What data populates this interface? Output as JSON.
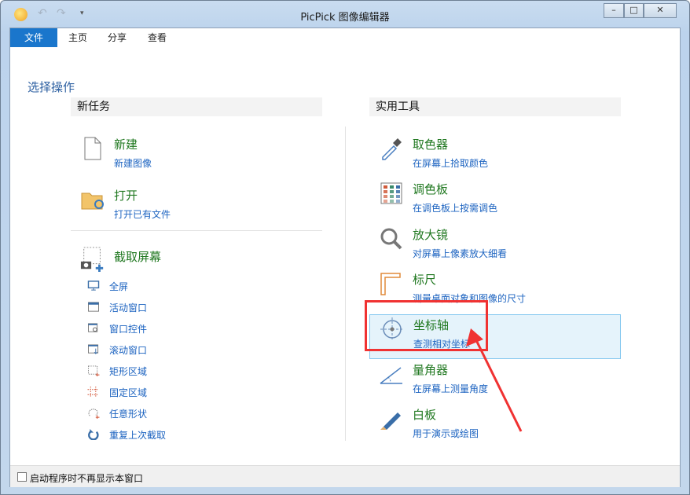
{
  "window": {
    "title": "PicPick 图像编辑器",
    "quick_access": [
      "undo-icon",
      "redo-icon",
      "customize-icon"
    ],
    "controls": [
      "minimize",
      "maximize",
      "close"
    ]
  },
  "menu": {
    "tabs": [
      "文件",
      "主页",
      "分享",
      "查看"
    ],
    "active": "文件"
  },
  "page": {
    "heading": "选择操作"
  },
  "new_task": {
    "header": "新任务",
    "items": [
      {
        "title": "新建",
        "sub": "新建图像",
        "icon": "new-file-icon"
      },
      {
        "title": "打开",
        "sub": "打开已有文件",
        "icon": "open-folder-icon"
      }
    ],
    "capture": {
      "title": "截取屏幕",
      "icon": "capture-camera-icon",
      "items": [
        {
          "label": "全屏",
          "icon": "monitor-icon"
        },
        {
          "label": "活动窗口",
          "icon": "window-icon"
        },
        {
          "label": "窗口控件",
          "icon": "window-control-icon"
        },
        {
          "label": "滚动窗口",
          "icon": "scroll-window-icon"
        },
        {
          "label": "矩形区域",
          "icon": "rectangle-region-icon"
        },
        {
          "label": "固定区域",
          "icon": "fixed-region-icon"
        },
        {
          "label": "任意形状",
          "icon": "freehand-icon"
        },
        {
          "label": "重复上次截取",
          "icon": "repeat-icon"
        }
      ]
    }
  },
  "tools": {
    "header": "实用工具",
    "items": [
      {
        "title": "取色器",
        "sub": "在屏幕上拾取颜色",
        "icon": "eyedropper-icon"
      },
      {
        "title": "调色板",
        "sub": "在调色板上按需调色",
        "icon": "palette-icon"
      },
      {
        "title": "放大镜",
        "sub": "对屏幕上像素放大细看",
        "icon": "magnifier-icon"
      },
      {
        "title": "标尺",
        "sub": "测量桌面对象和图像的尺寸",
        "icon": "ruler-icon"
      },
      {
        "title": "坐标轴",
        "sub": "查测相对坐标",
        "icon": "crosshair-icon",
        "selected": true
      },
      {
        "title": "量角器",
        "sub": "在屏幕上测量角度",
        "icon": "protractor-icon"
      },
      {
        "title": "白板",
        "sub": "用于演示或绘图",
        "icon": "pen-icon"
      }
    ]
  },
  "footer": {
    "checkbox_label": "启动程序时不再显示本窗口",
    "checked": false
  },
  "colors": {
    "accent": "#1a76cc",
    "title_green": "#207820",
    "link_blue": "#1c63c0",
    "annotation_red": "#f03232",
    "highlight": "#e5f3fb"
  }
}
